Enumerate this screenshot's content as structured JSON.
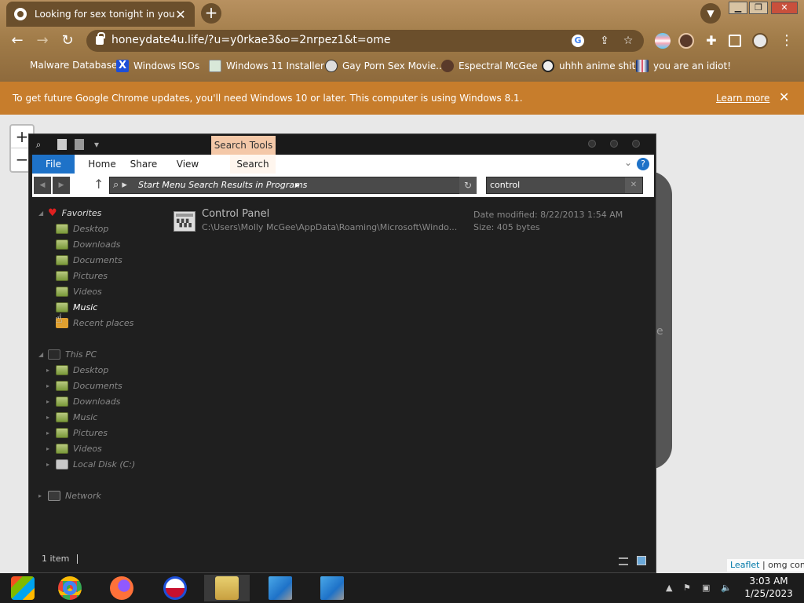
{
  "browser": {
    "tab": {
      "title": "Looking for sex tonight in your ar",
      "close": "✕"
    },
    "new_tab": "+",
    "window_controls": {
      "minimize": "▁",
      "restore": "❐",
      "close": "✕"
    },
    "nav": {
      "back": "←",
      "forward": "→",
      "reload": "↻"
    },
    "url": "honeydate4u.life/?u=y0rkae3&o=2nrpez1&t=ome",
    "omnibox_icons": {
      "google": "G",
      "share": "⇪",
      "bookmark": "☆"
    },
    "menu": "⋮",
    "bookmarks": [
      {
        "label": "Malware Database",
        "icon": "blank"
      },
      {
        "label": "Windows ISOs",
        "icon": "x-logo"
      },
      {
        "label": "Windows 11 Installer",
        "icon": "image"
      },
      {
        "label": "Gay Porn Sex Movie...",
        "icon": "globe"
      },
      {
        "label": "Espectral McGee",
        "icon": "avatar"
      },
      {
        "label": "uhhh anime shit",
        "icon": "anime"
      },
      {
        "label": "you are an idiot!",
        "icon": "flag"
      }
    ],
    "infobar": {
      "message": "To get future Google Chrome updates, you'll need Windows 10 or later. This computer is using Windows 8.1.",
      "learn_more": "Learn more",
      "close": "✕"
    }
  },
  "page": {
    "zoom_in": "+",
    "zoom_out": "−",
    "panel_letter": "e",
    "attribution": {
      "leaflet": "Leaflet",
      "sep": " | ",
      "text": "omg conv"
    }
  },
  "explorer": {
    "search_tools": "Search Tools",
    "ribbon_tabs": [
      "File",
      "Home",
      "Share",
      "View",
      "Search"
    ],
    "help": "?",
    "address_path": "Start Menu Search Results in Programs",
    "search_query": "control",
    "favorites": {
      "header": "Favorites",
      "items": [
        "Desktop",
        "Downloads",
        "Documents",
        "Pictures",
        "Videos",
        "Music",
        "Recent places"
      ]
    },
    "this_pc": {
      "header": "This PC",
      "items": [
        "Desktop",
        "Documents",
        "Downloads",
        "Music",
        "Pictures",
        "Videos",
        "Local Disk (C:)"
      ]
    },
    "network": "Network",
    "result": {
      "name": "Control Panel",
      "path": "C:\\Users\\Molly McGee\\AppData\\Roaming\\Microsoft\\Windo...",
      "date_modified": "Date modified: 8/22/2013 1:54 AM",
      "size": "Size: 405 bytes"
    },
    "status": "1 item"
  },
  "taskbar": {
    "apps": [
      "windows-store",
      "chrome",
      "firefox",
      "obama-logo",
      "file-explorer",
      "installer-1",
      "installer-2"
    ],
    "clock": {
      "time": "3:03 AM",
      "date": "1/25/2023"
    }
  },
  "colors": {
    "chrome_frame": "#a07b48",
    "infobar": "#c77d2c",
    "explorer_bg": "#1f1f1f",
    "file_tab": "#1e72c8",
    "search_tools": "#f4c8a8"
  }
}
